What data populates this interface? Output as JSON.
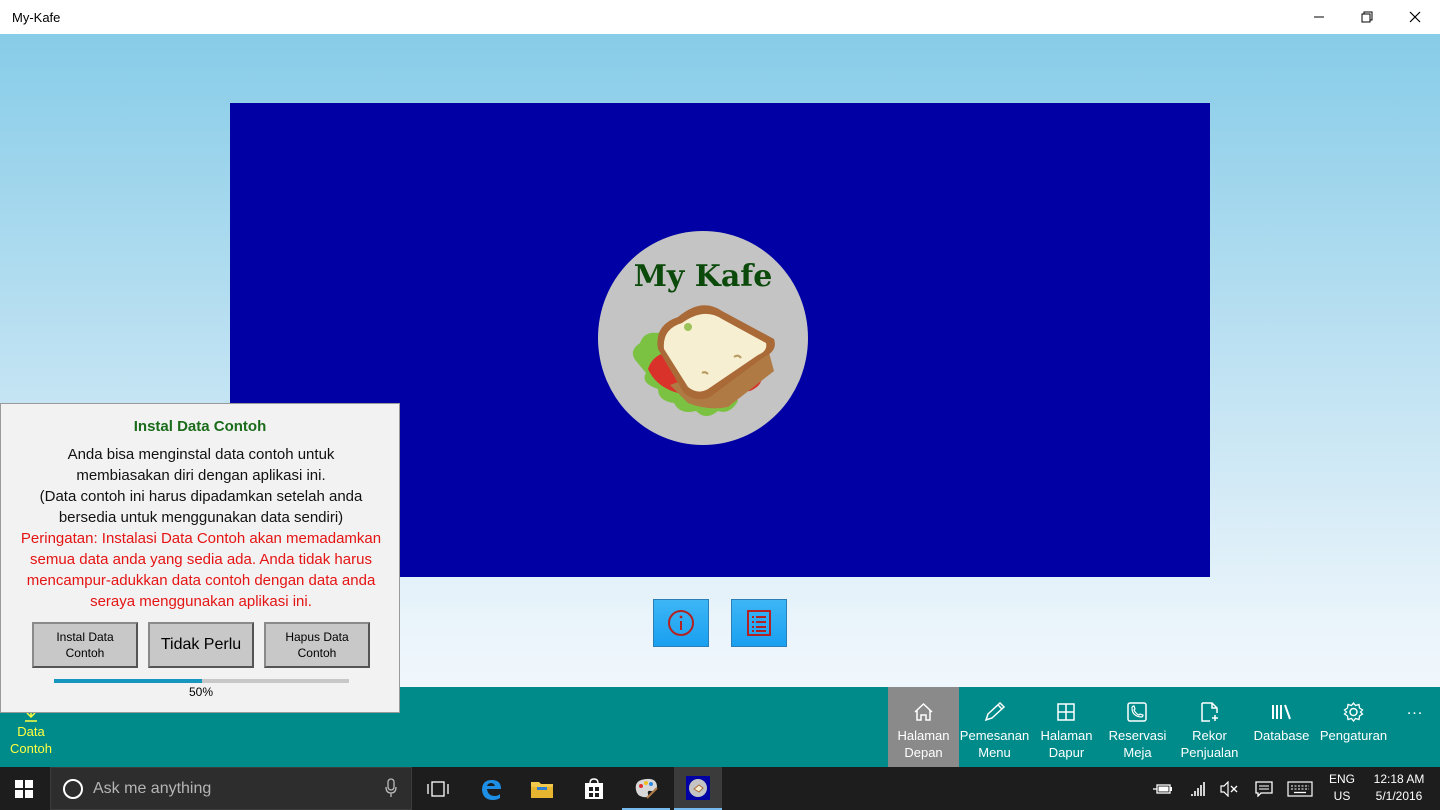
{
  "window": {
    "title": "My-Kafe",
    "minimize_glyph": "—",
    "maximize_glyph": "❐",
    "close_glyph": "✕"
  },
  "logo": {
    "text": "My Kafe",
    "image": "sandwich-illustration"
  },
  "center_buttons": [
    {
      "name": "info",
      "icon": "info-icon"
    },
    {
      "name": "list",
      "icon": "list-icon"
    }
  ],
  "popup": {
    "title": "Instal Data Contoh",
    "description_lines": [
      "Anda bisa menginstal data contoh untuk",
      "membiasakan diri dengan aplikasi ini.",
      "(Data contoh ini harus dipadamkan setelah anda",
      "bersedia untuk menggunakan data sendiri)"
    ],
    "warning_lines": [
      "Peringatan: Instalasi Data Contoh akan memadamkan",
      "semua data anda yang sedia ada. Anda tidak harus",
      "mencampur-adukkan data contoh dengan data anda",
      "seraya menggunakan aplikasi ini."
    ],
    "buttons": {
      "install": "Instal Data Contoh",
      "skip": "Tidak Perlu",
      "delete": "Hapus Data Contoh"
    },
    "progress": {
      "value": 0.5,
      "label": "50%"
    }
  },
  "nav": {
    "left_item": {
      "line1": "Data",
      "line2": "Contoh",
      "icon": "download-icon"
    },
    "items": [
      {
        "line1": "Halaman",
        "line2": "Depan",
        "icon": "home-icon",
        "active": true
      },
      {
        "line1": "Pemesanan",
        "line2": "Menu",
        "icon": "pencil-icon",
        "active": false
      },
      {
        "line1": "Halaman",
        "line2": "Dapur",
        "icon": "grid-icon",
        "active": false
      },
      {
        "line1": "Reservasi",
        "line2": "Meja",
        "icon": "phone-icon",
        "active": false
      },
      {
        "line1": "Rekor",
        "line2": "Penjualan",
        "icon": "document-icon",
        "active": false
      },
      {
        "line1": "Database",
        "line2": "",
        "icon": "library-icon",
        "active": false
      },
      {
        "line1": "Pengaturan",
        "line2": "",
        "icon": "gear-icon",
        "active": false
      }
    ],
    "more_glyph": "..."
  },
  "taskbar": {
    "search_placeholder": "Ask me anything",
    "language": {
      "line1": "ENG",
      "line2": "US"
    },
    "clock": {
      "time": "12:18 AM",
      "date": "5/1/2016"
    }
  },
  "colors": {
    "banner": "#0000a4",
    "nav_bg": "#008b8b",
    "nav_active": "#8a8a8a",
    "popup_title": "#1a6b1a",
    "warning": "#e51414",
    "button_blue": "#1aa0f0"
  }
}
